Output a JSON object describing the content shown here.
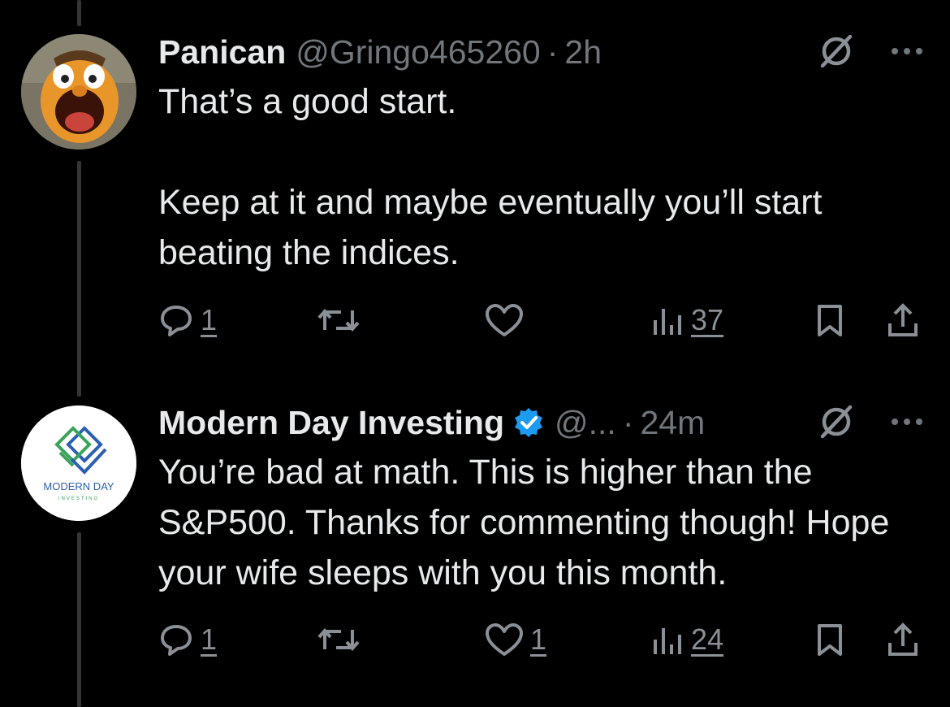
{
  "tweets": [
    {
      "author_name": "Panican",
      "handle": "@Gringo465260",
      "dot": "·",
      "time": "2h",
      "verified": false,
      "text_lines": [
        "That’s a good start.",
        "",
        "Keep at it and maybe eventually you’ll start beating the indices."
      ],
      "paragraph1": "That’s a good start.",
      "paragraph2": "Keep at it and maybe eventually you’ll start beating the indices.",
      "replies": "1",
      "reposts": "",
      "likes": "",
      "views": "37"
    },
    {
      "author_name": "Modern Day Investing",
      "handle": "@...",
      "dot": "·",
      "time": "24m",
      "verified": true,
      "paragraph1": "You’re bad at math. This is higher than the S&P500. Thanks for commenting though! Hope your wife sleeps with you this month.",
      "replies": "1",
      "reposts": "",
      "likes": "1",
      "views": "24",
      "avatar_logo_text": "MODERN DAY",
      "avatar_logo_subtext": "INVESTING"
    }
  ],
  "colors": {
    "background": "#000000",
    "text": "#e7e9ea",
    "muted": "#71767b",
    "verified": "#1d9bf0",
    "thread_line": "#333639",
    "logo_blue": "#2b5fb0",
    "logo_green": "#3aa35a"
  },
  "icons": [
    "reply-icon",
    "repost-icon",
    "like-icon",
    "views-icon",
    "bookmark-icon",
    "share-icon",
    "grok-icon",
    "more-icon",
    "verified-badge-icon"
  ]
}
